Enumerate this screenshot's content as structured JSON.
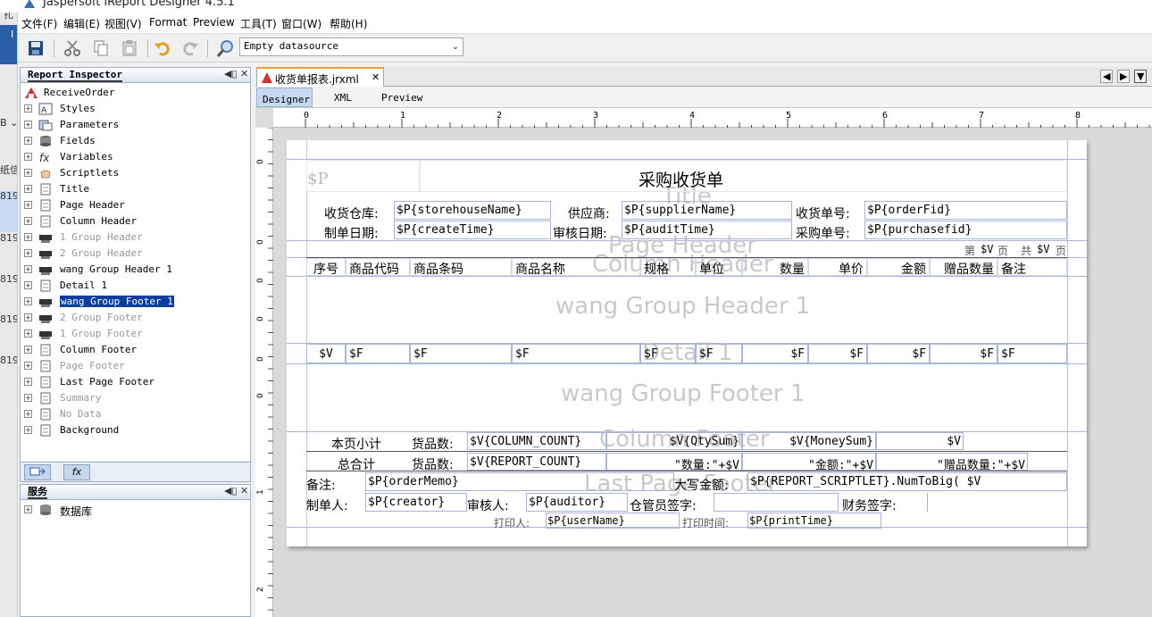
{
  "app": {
    "title": "Jaspersoft iReport Designer 4.5.1"
  },
  "menu": [
    "文件(F)",
    "编辑(E)",
    "视图(V)",
    "Format",
    "Preview",
    "工具(T)",
    "窗口(W)",
    "帮助(H)"
  ],
  "toolbar": {
    "datasource": "Empty datasource"
  },
  "left_edge": {
    "items": [
      "扎",
      "I",
      "B ⌄",
      "纸信",
      "819",
      "819",
      "819",
      "819",
      "819"
    ]
  },
  "inspector": {
    "title": "Report Inspector",
    "root": "ReceiveOrder",
    "items": [
      {
        "label": "Styles",
        "icon": "styles-icon",
        "dim": false
      },
      {
        "label": "Parameters",
        "icon": "parameters-icon",
        "dim": false
      },
      {
        "label": "Fields",
        "icon": "fields-icon",
        "dim": false
      },
      {
        "label": "Variables",
        "icon": "variables-icon",
        "dim": false
      },
      {
        "label": "Scriptlets",
        "icon": "scriptlets-icon",
        "dim": false
      },
      {
        "label": "Title",
        "icon": "band-icon",
        "dim": false
      },
      {
        "label": "Page Header",
        "icon": "band-icon",
        "dim": false
      },
      {
        "label": "Column Header",
        "icon": "band-icon",
        "dim": false
      },
      {
        "label": "1 Group Header",
        "icon": "group-icon",
        "dim": true
      },
      {
        "label": "2 Group Header",
        "icon": "group-icon",
        "dim": true
      },
      {
        "label": "wang Group Header 1",
        "icon": "group-icon",
        "dim": false
      },
      {
        "label": "Detail 1",
        "icon": "band-icon",
        "dim": false
      },
      {
        "label": "wang Group Footer 1",
        "icon": "group-icon",
        "dim": false,
        "selected": true
      },
      {
        "label": "2 Group Footer",
        "icon": "group-icon",
        "dim": true
      },
      {
        "label": "1 Group Footer",
        "icon": "group-icon",
        "dim": true
      },
      {
        "label": "Column Footer",
        "icon": "band-icon",
        "dim": false
      },
      {
        "label": "Page Footer",
        "icon": "band-icon",
        "dim": true
      },
      {
        "label": "Last Page Footer",
        "icon": "band-icon",
        "dim": false
      },
      {
        "label": "Summary",
        "icon": "band-icon",
        "dim": true
      },
      {
        "label": "No Data",
        "icon": "band-icon",
        "dim": true
      },
      {
        "label": "Background",
        "icon": "band-icon",
        "dim": false
      }
    ],
    "fx_label": "fx"
  },
  "services": {
    "title": "服务",
    "items": [
      "数据库"
    ]
  },
  "editor": {
    "tab_label": "收货单报表.jrxml",
    "sub_tabs": [
      "Designer",
      "XML",
      "Preview"
    ],
    "ruler_labels": [
      "0",
      "1",
      "2",
      "3",
      "4",
      "5",
      "6",
      "7",
      "8"
    ],
    "vruler_labels": [
      "0",
      "0",
      "0",
      "0",
      "0",
      "0",
      "1",
      "2"
    ]
  },
  "report": {
    "band_labels": [
      "Title",
      "Page Header",
      "Column Header",
      "wang Group Header 1",
      "Detail 1",
      "wang Group Footer 1",
      "Column Footer",
      "Last Page Footer"
    ],
    "title_param": "$P",
    "title_text": "采购收货单",
    "row1": {
      "l1": "收货仓库:",
      "v1": "$P{storehouseName}",
      "l2": "供应商:",
      "v2": "$P{supplierName}",
      "l3": "收货单号:",
      "v3": "$P{orderFid}"
    },
    "row2": {
      "l1": "制单日期:",
      "v1": "$P{createTime}",
      "l2": "审核日期:",
      "v2": "$P{auditTime}",
      "l3": "采购单号:",
      "v3": "$P{purchasefid}"
    },
    "page_info": [
      "第",
      "$V",
      "页",
      "共",
      "$V",
      "页"
    ],
    "column_headers": [
      "序号",
      "商品代码",
      "商品条码",
      "商品名称",
      "规格",
      "单位",
      "数量",
      "单价",
      "金额",
      "赠品数量",
      "备注"
    ],
    "detail_cells": [
      "$V",
      "$F",
      "$F",
      "$F",
      "$F",
      "$F",
      "$F",
      "$F",
      "$F",
      "$F",
      "$F"
    ],
    "column_footer": {
      "label": "本页小计",
      "count_label": "货品数:",
      "count": "$V{COLUMN_COUNT}",
      "qty": "$V{QtySum}",
      "money": "$V{MoneySum}",
      "gift": "$V"
    },
    "total": {
      "label": "总合计",
      "count_label": "货品数:",
      "count": "$V{REPORT_COUNT}",
      "qty": "\"数量:\"+$V",
      "money": "\"金额:\"+$V",
      "gift": "\"赠品数量:\"+$V"
    },
    "memo": {
      "label": "备注:",
      "value": "$P{orderMemo}",
      "big_label": "大写金额:",
      "big_value": "$P{REPORT_SCRIPTLET}.NumToBig( $V"
    },
    "signers": {
      "maker_label": "制单人:",
      "maker": "$P{creator}",
      "auditor_label": "审核人:",
      "auditor": "$P{auditor}",
      "warehouse": "仓管员签字:",
      "finance": "财务签字:"
    },
    "print": {
      "user_label": "打印人:",
      "user": "$P{userName}",
      "time_label": "打印时间:",
      "time": "$P{printTime}"
    }
  }
}
